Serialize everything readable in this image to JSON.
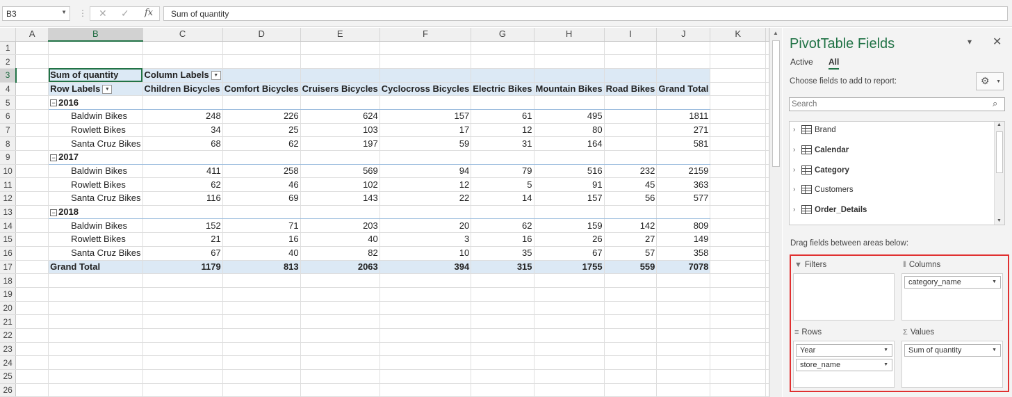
{
  "formula_bar": {
    "name_box": "B3",
    "cancel_glyph": "✕",
    "enter_glyph": "✓",
    "fx_label": "fx",
    "formula": "Sum of quantity"
  },
  "grid": {
    "columns": [
      "A",
      "B",
      "C",
      "D",
      "E",
      "F",
      "G",
      "H",
      "I",
      "J",
      "K"
    ],
    "row_numbers": [
      "1",
      "2",
      "3",
      "4",
      "5",
      "6",
      "7",
      "8",
      "9",
      "10",
      "11",
      "12",
      "13",
      "14",
      "15",
      "16",
      "17",
      "18",
      "19",
      "20",
      "21",
      "22",
      "23",
      "24",
      "25",
      "26"
    ],
    "selected_cell": "B3"
  },
  "pivot": {
    "value_label": "Sum of quantity",
    "column_labels": "Column Labels",
    "row_labels": "Row Labels",
    "headers": [
      "Children Bicycles",
      "Comfort Bicycles",
      "Cruisers Bicycles",
      "Cyclocross Bicycles",
      "Electric Bikes",
      "Mountain Bikes",
      "Road Bikes",
      "Grand Total"
    ],
    "groups": [
      {
        "year": "2016",
        "rows": [
          {
            "store": "Baldwin Bikes",
            "values": [
              "248",
              "226",
              "624",
              "157",
              "61",
              "495",
              "",
              "1811"
            ]
          },
          {
            "store": "Rowlett Bikes",
            "values": [
              "34",
              "25",
              "103",
              "17",
              "12",
              "80",
              "",
              "271"
            ]
          },
          {
            "store": "Santa Cruz Bikes",
            "values": [
              "68",
              "62",
              "197",
              "59",
              "31",
              "164",
              "",
              "581"
            ]
          }
        ]
      },
      {
        "year": "2017",
        "rows": [
          {
            "store": "Baldwin Bikes",
            "values": [
              "411",
              "258",
              "569",
              "94",
              "79",
              "516",
              "232",
              "2159"
            ]
          },
          {
            "store": "Rowlett Bikes",
            "values": [
              "62",
              "46",
              "102",
              "12",
              "5",
              "91",
              "45",
              "363"
            ]
          },
          {
            "store": "Santa Cruz Bikes",
            "values": [
              "116",
              "69",
              "143",
              "22",
              "14",
              "157",
              "56",
              "577"
            ]
          }
        ]
      },
      {
        "year": "2018",
        "rows": [
          {
            "store": "Baldwin Bikes",
            "values": [
              "152",
              "71",
              "203",
              "20",
              "62",
              "159",
              "142",
              "809"
            ]
          },
          {
            "store": "Rowlett Bikes",
            "values": [
              "21",
              "16",
              "40",
              "3",
              "16",
              "26",
              "27",
              "149"
            ]
          },
          {
            "store": "Santa Cruz Bikes",
            "values": [
              "67",
              "40",
              "82",
              "10",
              "35",
              "67",
              "57",
              "358"
            ]
          }
        ]
      }
    ],
    "grand_total_label": "Grand Total",
    "grand_totals": [
      "1179",
      "813",
      "2063",
      "394",
      "315",
      "1755",
      "559",
      "7078"
    ]
  },
  "pane": {
    "title": "PivotTable Fields",
    "minimize_glyph": "▾",
    "close_glyph": "✕",
    "tabs": [
      "Active",
      "All"
    ],
    "active_tab": "All",
    "choose_label": "Choose fields to add to report:",
    "search_placeholder": "Search",
    "fields": [
      {
        "name": "Brand",
        "bold": false
      },
      {
        "name": "Calendar",
        "bold": true
      },
      {
        "name": "Category",
        "bold": true
      },
      {
        "name": "Customers",
        "bold": false
      },
      {
        "name": "Order_Details",
        "bold": true
      }
    ],
    "drag_label": "Drag fields between areas below:",
    "areas": {
      "filters": {
        "title": "Filters",
        "items": []
      },
      "columns": {
        "title": "Columns",
        "items": [
          "category_name"
        ]
      },
      "rows": {
        "title": "Rows",
        "items": [
          "Year",
          "store_name"
        ]
      },
      "values": {
        "title": "Values",
        "items": [
          "Sum of quantity"
        ]
      }
    },
    "highlight_color": "#e03030",
    "accent_color": "#217346"
  }
}
